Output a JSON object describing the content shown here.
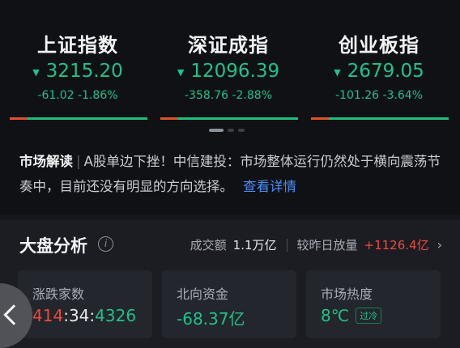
{
  "indices": [
    {
      "name": "上证指数",
      "value": "3215.20",
      "change": "-61.02 -1.86%"
    },
    {
      "name": "深证成指",
      "value": "12096.39",
      "change": "-358.76 -2.88%"
    },
    {
      "name": "创业板指",
      "value": "2679.05",
      "change": "-101.26 -3.64%"
    }
  ],
  "market_interpretation": {
    "label": "市场解读",
    "separator": "|",
    "text": "A股单边下挫！中信建投：市场整体运行仍然处于横向震荡节奏中，目前还没有明显的方向选择。",
    "link": "查看详情"
  },
  "market_analysis": {
    "title": "大盘分析",
    "turnover_label": "成交额",
    "turnover_value": "1.1万亿",
    "compare_label": "较昨日放量",
    "compare_value": "+1126.4亿",
    "boxes": {
      "advance_decline": {
        "label": "涨跌家数",
        "up": "414",
        "flat": "34",
        "down": "4326"
      },
      "northbound": {
        "label": "北向资金",
        "value": "-68.37亿"
      },
      "heat": {
        "label": "市场热度",
        "value": "8℃",
        "badge": "过冷"
      }
    }
  },
  "colors": {
    "down_green": "#1fc28a",
    "up_red": "#f0483a",
    "link_blue": "#4a8df5"
  }
}
